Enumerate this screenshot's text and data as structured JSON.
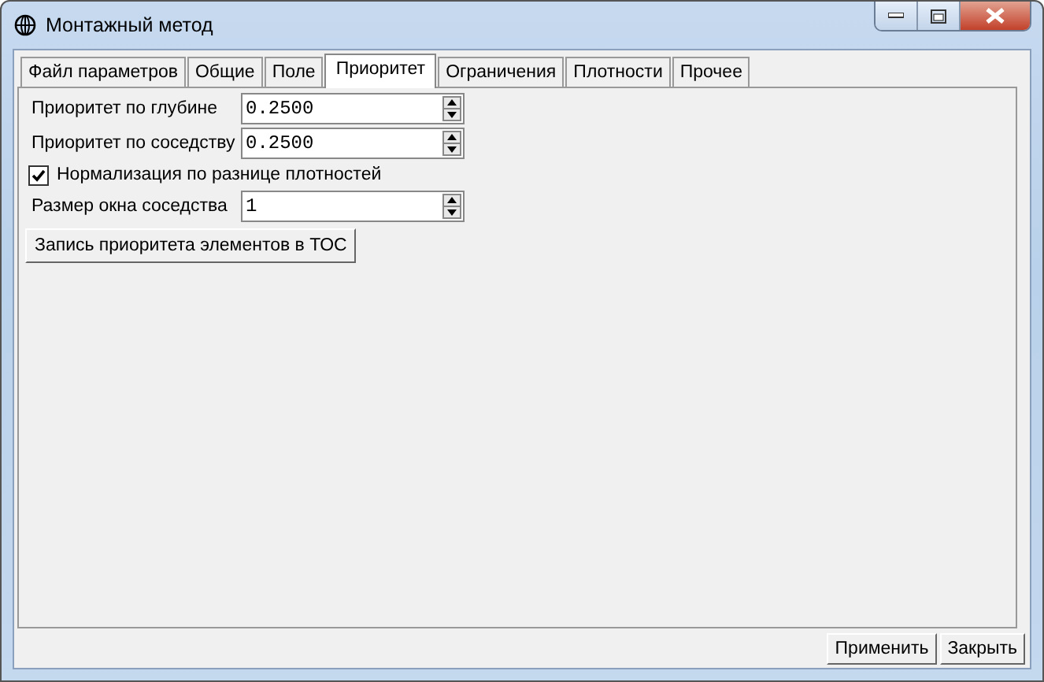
{
  "window": {
    "title": "Монтажный метод"
  },
  "tabs": [
    {
      "label": "Файл параметров",
      "selected": false
    },
    {
      "label": "Общие",
      "selected": false
    },
    {
      "label": "Поле",
      "selected": false
    },
    {
      "label": "Приоритет",
      "selected": true
    },
    {
      "label": "Ограничения",
      "selected": false
    },
    {
      "label": "Плотности",
      "selected": false
    },
    {
      "label": "Прочее",
      "selected": false
    }
  ],
  "fields": [
    {
      "kind": "spin",
      "label": "Приоритет по глубине",
      "value": "0.2500"
    },
    {
      "kind": "spin",
      "label": "Приоритет по соседству",
      "value": "0.2500"
    },
    {
      "kind": "checkbox",
      "label": "Нормализация по разнице плотностей",
      "checked": true
    },
    {
      "kind": "spin",
      "label": "Размер окна соседства",
      "value": "1"
    },
    {
      "kind": "button",
      "label": "Запись приоритета элементов в ТОС"
    }
  ],
  "buttons": [
    "Применить",
    "Закрыть"
  ]
}
